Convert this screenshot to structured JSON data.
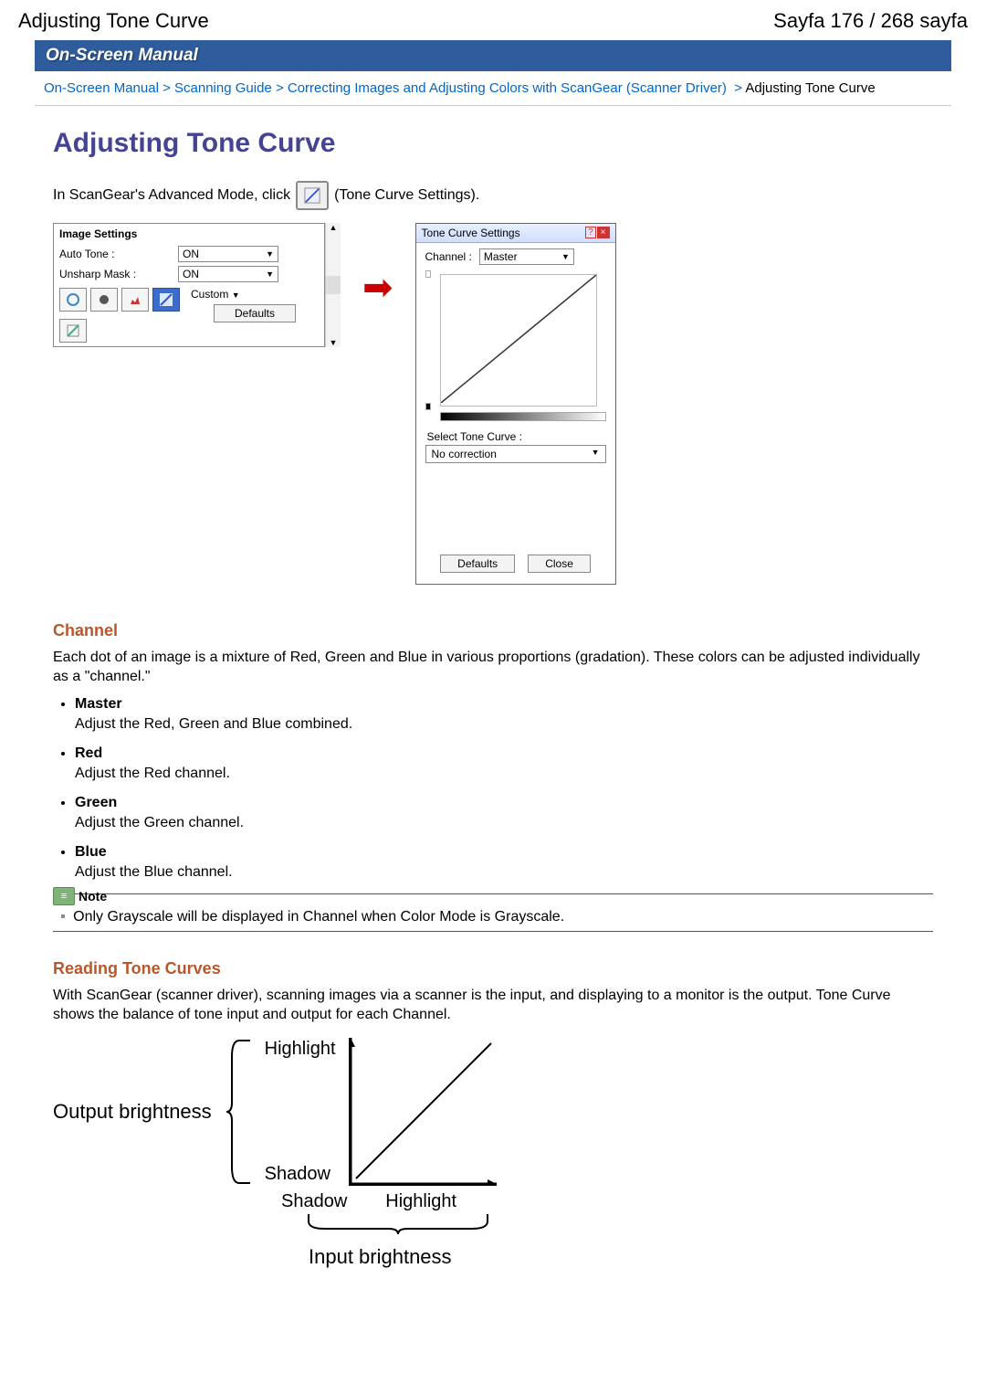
{
  "header": {
    "title_left": "Adjusting Tone Curve",
    "title_right": "Sayfa 176 / 268 sayfa"
  },
  "manual_bar": "On-Screen Manual",
  "breadcrumb": {
    "items": [
      "On-Screen Manual",
      "Scanning Guide",
      "Correcting Images and Adjusting Colors with ScanGear (Scanner Driver)"
    ],
    "current": "Adjusting Tone Curve",
    "sep": ">"
  },
  "page_title": "Adjusting Tone Curve",
  "intro": {
    "before": "In ScanGear's Advanced Mode, click",
    "after": "(Tone Curve Settings)."
  },
  "image_settings_panel": {
    "title": "Image Settings",
    "rows": [
      {
        "label": "Auto Tone :",
        "value": "ON"
      },
      {
        "label": "Unsharp Mask :",
        "value": "ON"
      }
    ],
    "mode_value": "Custom",
    "defaults_btn": "Defaults"
  },
  "tone_curve_panel": {
    "title": "Tone Curve Settings",
    "channel_label": "Channel :",
    "channel_value": "Master",
    "select_label": "Select Tone Curve :",
    "select_value": "No correction",
    "defaults_btn": "Defaults",
    "close_btn": "Close"
  },
  "sections": {
    "channel_heading": "Channel",
    "channel_intro": "Each dot of an image is a mixture of Red, Green and Blue in various proportions (gradation). These colors can be adjusted individually as a \"channel.\"",
    "channel_items": [
      {
        "title": "Master",
        "desc": "Adjust the Red, Green and Blue combined."
      },
      {
        "title": "Red",
        "desc": "Adjust the Red channel."
      },
      {
        "title": "Green",
        "desc": "Adjust the Green channel."
      },
      {
        "title": "Blue",
        "desc": "Adjust the Blue channel."
      }
    ],
    "note_label": "Note",
    "note_text": "Only Grayscale will be displayed in Channel when Color Mode is Grayscale.",
    "reading_heading": "Reading Tone Curves",
    "reading_text": "With ScanGear (scanner driver), scanning images via a scanner is the input, and displaying to a monitor is the output. Tone Curve shows the balance of tone input and output for each Channel."
  },
  "diagram": {
    "y_label": "Output brightness",
    "y_top": "Highlight",
    "y_bottom": "Shadow",
    "x_left": "Shadow",
    "x_right": "Highlight",
    "x_label": "Input brightness"
  }
}
